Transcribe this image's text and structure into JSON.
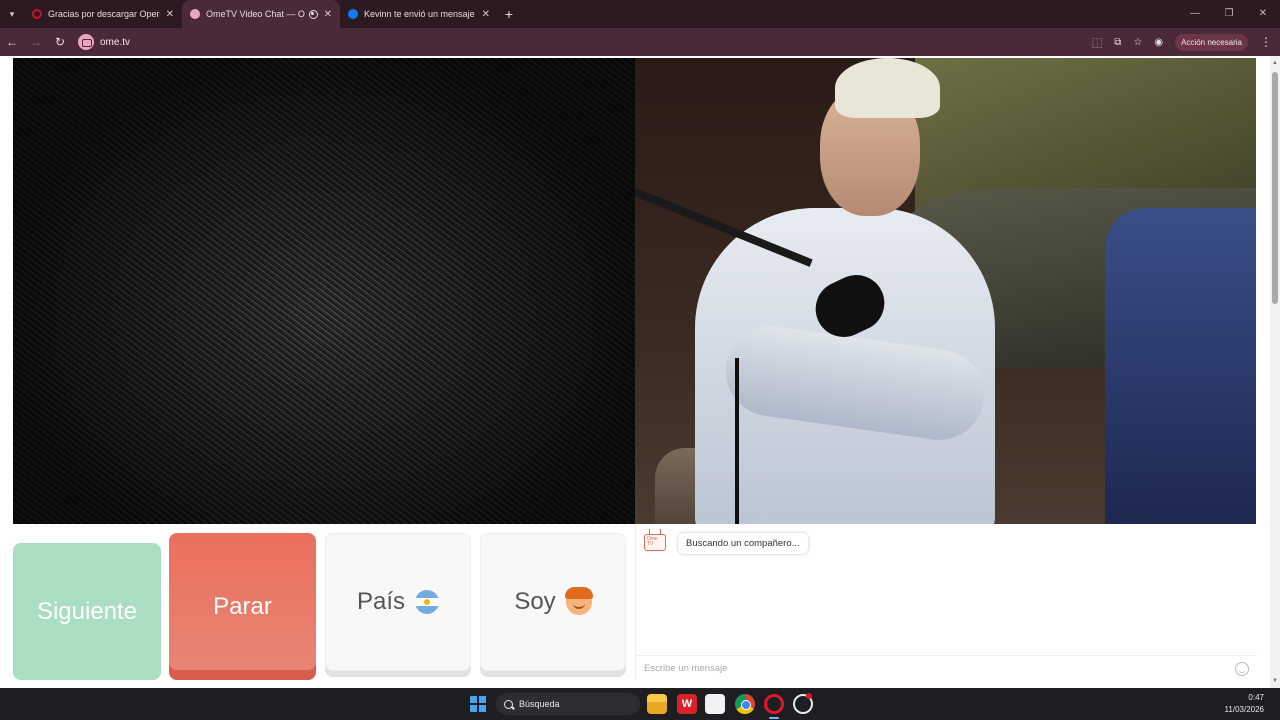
{
  "browser": {
    "tabs": [
      {
        "title": "Gracias por descargar Opera",
        "active": false,
        "favicon_color": "#c8102e"
      },
      {
        "title": "OmeTV Video Chat — Ome",
        "active": true,
        "favicon_color": "#e9a8bf"
      },
      {
        "title": "Kevinn te envió un mensaje",
        "active": false,
        "favicon_color": "#1877f2"
      }
    ],
    "new_tab_icon": "plus-icon",
    "url": "ome.tv",
    "action_required": "Acción necesaria"
  },
  "buttons": {
    "next": "Siguiente",
    "stop": "Parar",
    "country": "País",
    "gender": "Soy"
  },
  "chat": {
    "status_message": "Buscando un compañero...",
    "logo_text": "Ome TV",
    "input_placeholder": "Escribe un mensaje"
  },
  "taskbar": {
    "search_label": "Búsqueda",
    "time": "0:47",
    "date": "11/03/2026"
  },
  "colors": {
    "next_button": "#a9dec0",
    "stop_button": "#ea6f5c",
    "browser_chrome": "#4a2a38"
  }
}
